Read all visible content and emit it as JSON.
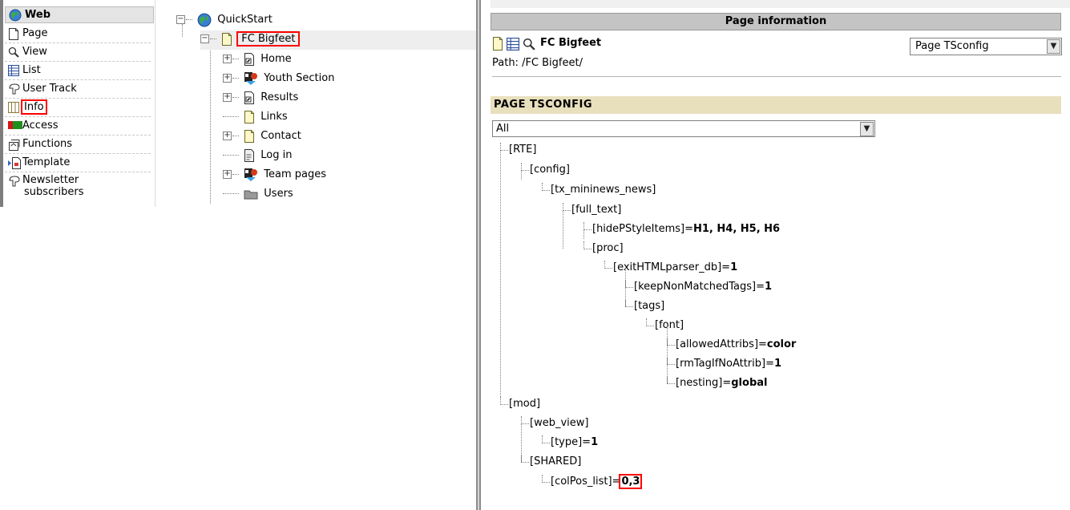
{
  "module_menu": {
    "section_title": "Web",
    "items": [
      {
        "label": "Page",
        "icon": "page-icon"
      },
      {
        "label": "View",
        "icon": "magnifier-icon"
      },
      {
        "label": "List",
        "icon": "list-icon"
      },
      {
        "label": "User Track",
        "icon": "user-track-icon"
      },
      {
        "label": "Info",
        "icon": "info-columns-icon"
      },
      {
        "label": "Access",
        "icon": "access-icon"
      },
      {
        "label": "Functions",
        "icon": "functions-icon"
      },
      {
        "label": "Template",
        "icon": "template-icon"
      },
      {
        "label": "Newsletter",
        "label2": "subscribers",
        "icon": "newsletter-icon"
      }
    ]
  },
  "page_tree": {
    "root": "QuickStart",
    "selected": "FC Bigfeet",
    "children": [
      "Home",
      "Youth Section",
      "Results",
      "Links",
      "Contact",
      "Log in",
      "Team pages",
      "Users"
    ]
  },
  "content": {
    "header": "Page information",
    "page_title": "FC Bigfeet",
    "path": "Path: /FC Bigfeet/",
    "function_select": "Page TSconfig",
    "section_title": "PAGE TSCONFIG",
    "filter_select": "All",
    "tsconfig": [
      {
        "key": "[RTE]",
        "value": ""
      },
      {
        "key": "[config]",
        "value": ""
      },
      {
        "key": "[tx_mininews_news]",
        "value": ""
      },
      {
        "key": "[full_text]",
        "value": ""
      },
      {
        "key": "[hidePStyleItems]=",
        "value": "H1, H4, H5, H6"
      },
      {
        "key": "[proc]",
        "value": ""
      },
      {
        "key": "[exitHTMLparser_db]=",
        "value": "1"
      },
      {
        "key": "[keepNonMatchedTags]=",
        "value": "1"
      },
      {
        "key": "[tags]",
        "value": ""
      },
      {
        "key": "[font]",
        "value": ""
      },
      {
        "key": "[allowedAttribs]=",
        "value": "color"
      },
      {
        "key": "[rmTagIfNoAttrib]=",
        "value": "1"
      },
      {
        "key": "[nesting]=",
        "value": "global"
      },
      {
        "key": "[mod]",
        "value": ""
      },
      {
        "key": "[web_view]",
        "value": ""
      },
      {
        "key": "[type]=",
        "value": "1"
      },
      {
        "key": "[SHARED]",
        "value": ""
      },
      {
        "key": "[colPos_list]=",
        "value": "0,3"
      }
    ]
  },
  "colors": {
    "highlight_box": "#ff0000",
    "section_bar": "#e8dfbd",
    "header_bar": "#c4c4c4"
  }
}
